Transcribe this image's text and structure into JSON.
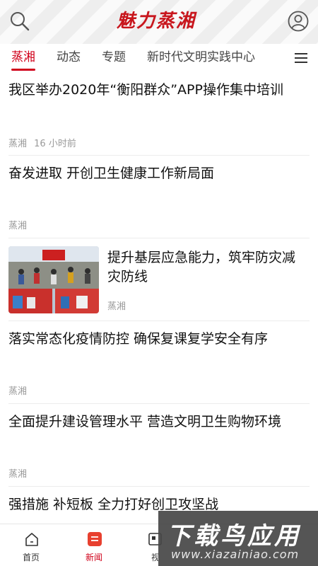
{
  "header": {
    "logo_text": "魅力蒸湘",
    "brand_color": "#c8161d",
    "search_icon": "search-icon",
    "user_icon": "user-icon"
  },
  "tabs": [
    {
      "label": "蒸湘",
      "active": true
    },
    {
      "label": "动态",
      "active": false
    },
    {
      "label": "专题",
      "active": false
    },
    {
      "label": "新时代文明实践中心",
      "active": false
    }
  ],
  "menu_icon": "menu-icon",
  "accent_color": "#d0021b",
  "feed": [
    {
      "title": "我区举办2020年“衡阳群众”APP操作集中培训",
      "source": "蒸湘",
      "time": "16 小时前"
    },
    {
      "title": "奋发进取 开创卫生健康工作新局面",
      "source": "蒸湘"
    },
    {
      "title": "提升基层应急能力，筑牢防灾减灾防线",
      "source": "蒸湘",
      "has_image": true
    },
    {
      "title": "落实常态化疫情防控 确保复课复学安全有序",
      "source": "蒸湘"
    },
    {
      "title": "全面提升建设管理水平 营造文明卫生购物环境",
      "source": "蒸湘"
    },
    {
      "title": "强措施 补短板 全力打好创卫攻坚战"
    }
  ],
  "bottom_nav": [
    {
      "label": "首页",
      "icon": "home-icon",
      "active": false
    },
    {
      "label": "新闻",
      "icon": "news-icon",
      "active": true
    },
    {
      "label": "视",
      "icon": "video-icon",
      "active": false
    }
  ],
  "watermark": {
    "big": "下载鸟应用",
    "small": "www.xiazainiao.com"
  }
}
